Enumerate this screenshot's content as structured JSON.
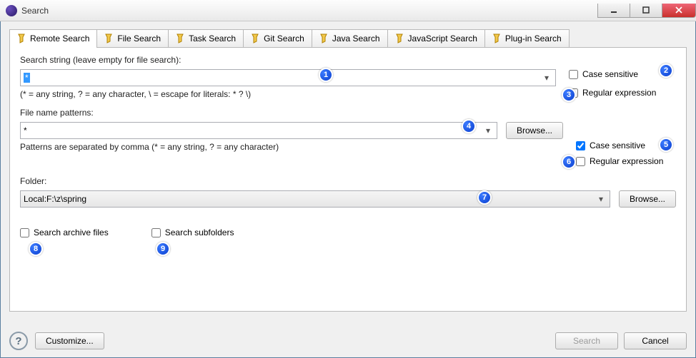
{
  "window": {
    "title": "Search"
  },
  "tabs": [
    {
      "label": "Remote Search",
      "active": true
    },
    {
      "label": "File Search"
    },
    {
      "label": "Task Search"
    },
    {
      "label": "Git Search"
    },
    {
      "label": "Java Search"
    },
    {
      "label": "JavaScript Search"
    },
    {
      "label": "Plug-in Search"
    }
  ],
  "form": {
    "searchStringLabel": "Search string (leave empty for file search):",
    "searchStringValue": "*",
    "searchStringHint": "(* = any string, ? = any character, \\ = escape for literals: * ? \\)",
    "caseSensitive1Label": "Case sensitive",
    "caseSensitive1": false,
    "regex1Label": "Regular expression",
    "regex1": false,
    "fileNamePatternsLabel": "File name patterns:",
    "fileNamePatternsValue": "*",
    "browseLabel": "Browse...",
    "patternsHint": "Patterns are separated by comma (* = any string, ? = any character)",
    "caseSensitive2Label": "Case sensitive",
    "caseSensitive2": true,
    "regex2Label": "Regular expression",
    "regex2": false,
    "folderLabel": "Folder:",
    "folderValue": "Local:F:\\z\\spring",
    "searchArchiveLabel": "Search archive files",
    "searchArchive": false,
    "searchSubfoldersLabel": "Search subfolders",
    "searchSubfolders": false
  },
  "footer": {
    "customize": "Customize...",
    "search": "Search",
    "cancel": "Cancel"
  },
  "annotations": [
    "1",
    "2",
    "3",
    "4",
    "5",
    "6",
    "7",
    "8",
    "9"
  ]
}
